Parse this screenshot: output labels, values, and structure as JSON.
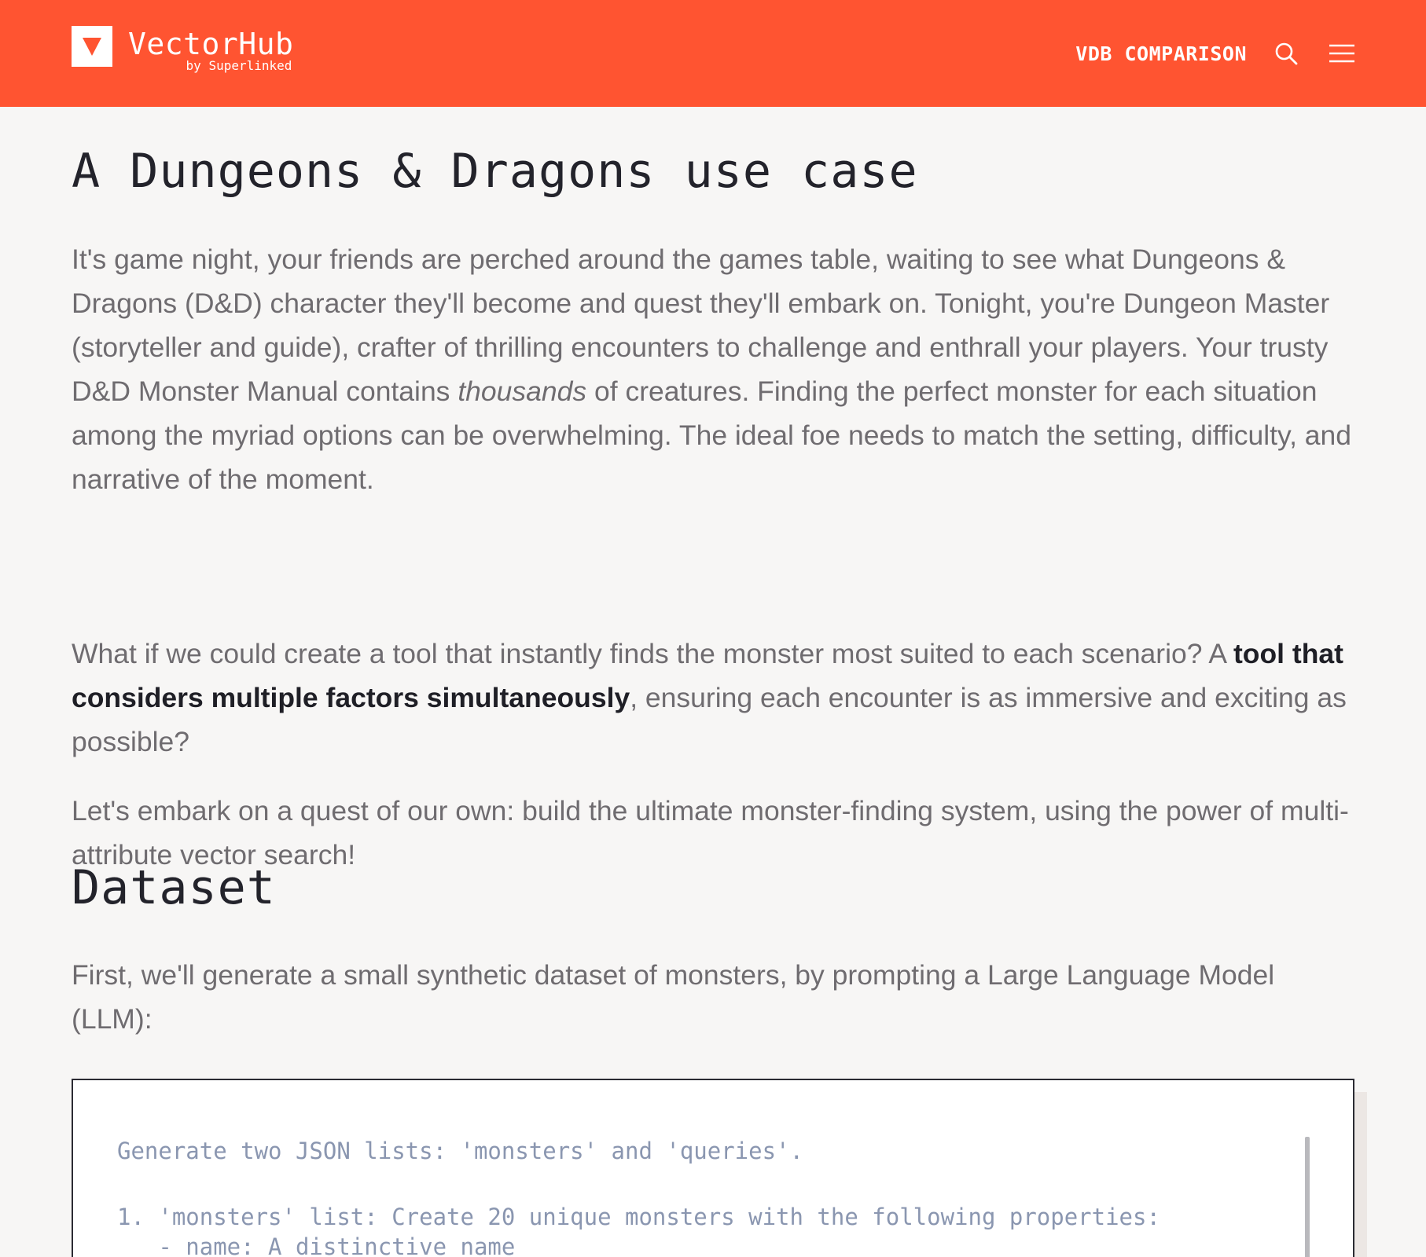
{
  "header": {
    "brand_title": "VectorHub",
    "brand_subtitle": "by Superlinked",
    "nav_link": "VDB COMPARISON",
    "search_icon": "search-icon",
    "menu_icon": "hamburger-menu-icon",
    "background_color": "#ff5431"
  },
  "article": {
    "title": "A Dungeons & Dragons use case",
    "paragraphs": [
      {
        "before": "It's game night, your friends are perched around the games table, waiting to see what Dungeons & Dragons (D&D) character they'll become and quest they'll embark on. Tonight, you're Dungeon Master (storyteller and guide), crafter of thrilling encounters to challenge and enthrall your players. Your trusty D&D Monster Manual contains ",
        "emphasis": "thousands",
        "after": " of creatures. Finding the perfect monster for each situation among the myriad options can be overwhelming. The ideal foe needs to match the setting, difficulty, and narrative of the moment."
      },
      {
        "before": "What if we could create a tool that instantly finds the monster most suited to each scenario? A ",
        "strong": "tool that considers multiple factors simultaneously",
        "after": ", ensuring each encounter is as immersive and exciting as possible?"
      },
      {
        "text": "Let's embark on a quest of our own: build the ultimate monster-finding system, using the power of multi-attribute vector search!"
      }
    ],
    "section_heading": "Dataset",
    "dataset_intro": "First, we'll generate a small synthetic dataset of monsters, by prompting a Large Language Model (LLM):",
    "code_lines": [
      "Generate two JSON lists: 'monsters' and 'queries'.",
      "1. 'monsters' list: Create 20 unique monsters with the following properties:",
      "   - name: A distinctive name"
    ]
  }
}
